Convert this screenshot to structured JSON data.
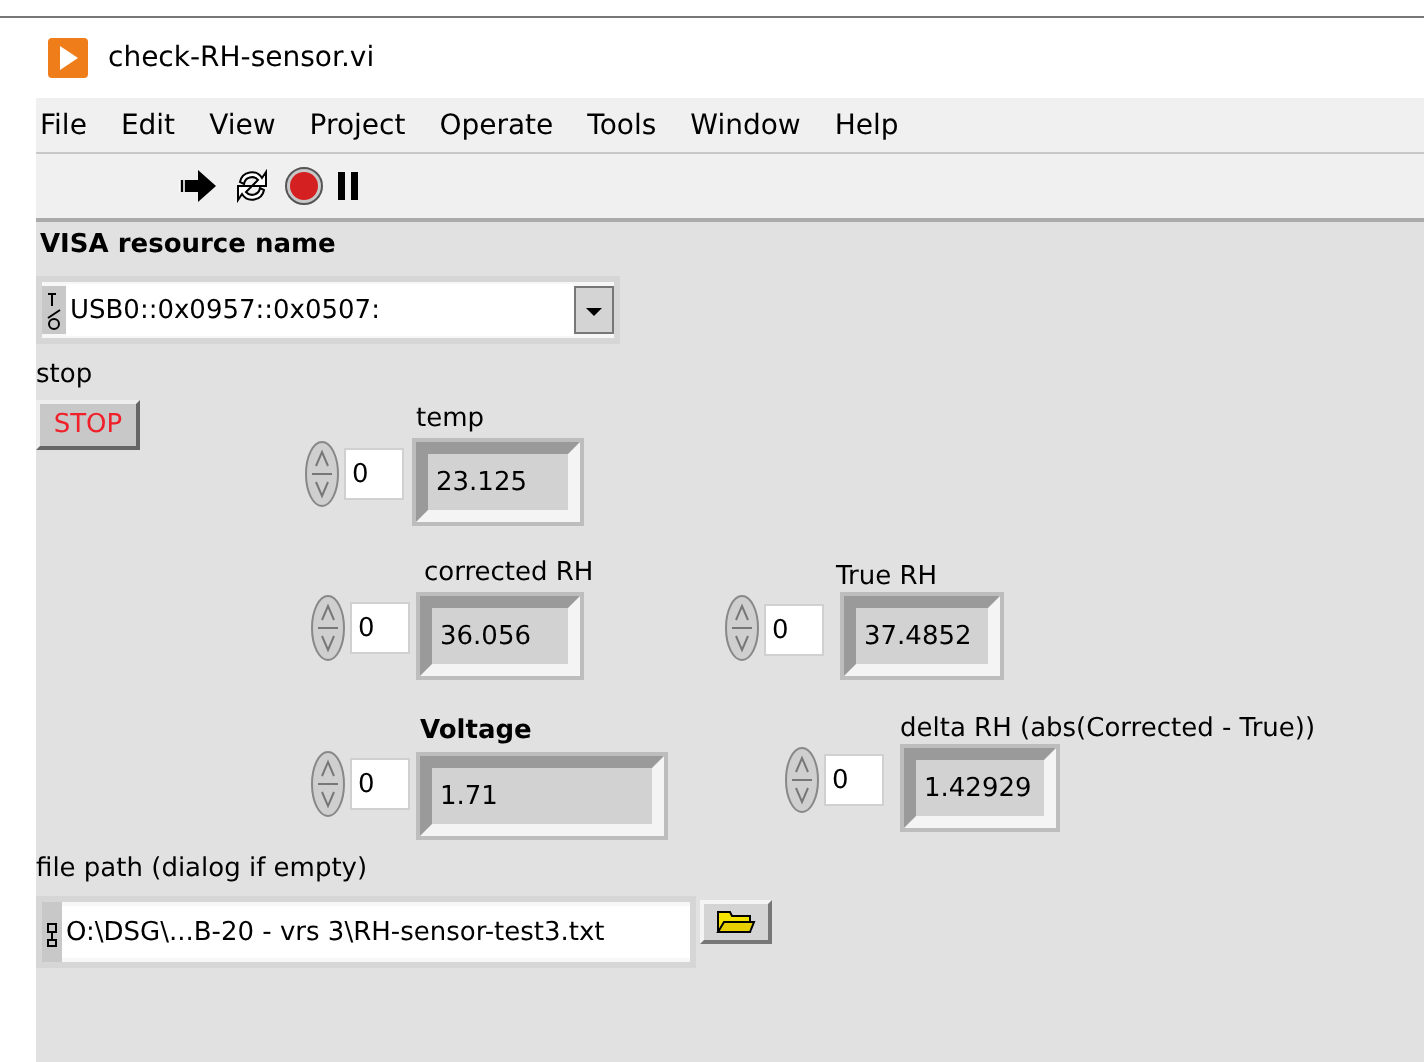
{
  "window": {
    "title": "check-RH-sensor.vi"
  },
  "menu": [
    "File",
    "Edit",
    "View",
    "Project",
    "Operate",
    "Tools",
    "Window",
    "Help"
  ],
  "controls": [
    {
      "kind": "visa",
      "label": "VISA resource name",
      "value": "USB0::0x0957::0x0507:"
    },
    {
      "kind": "button",
      "label": "stop",
      "text": "STOP"
    },
    {
      "kind": "numeric",
      "label": "temp",
      "emphasis": false,
      "index": "0",
      "value": "23.125"
    },
    {
      "kind": "numeric",
      "label": "corrected RH",
      "emphasis": false,
      "index": "0",
      "value": "36.056"
    },
    {
      "kind": "numeric",
      "label": "True RH",
      "emphasis": false,
      "index": "0",
      "value": "37.4852"
    },
    {
      "kind": "numeric",
      "label": "Voltage",
      "emphasis": true,
      "index": "0",
      "value": "1.71"
    },
    {
      "kind": "numeric",
      "label": "delta RH (abs(Corrected - True))",
      "emphasis": false,
      "index": "0",
      "value": "1.42929"
    },
    {
      "kind": "path",
      "label": "file path (dialog if empty)",
      "value": "O:\\DSG\\...B-20 - vrs 3\\RH-sensor-test3.txt"
    }
  ]
}
